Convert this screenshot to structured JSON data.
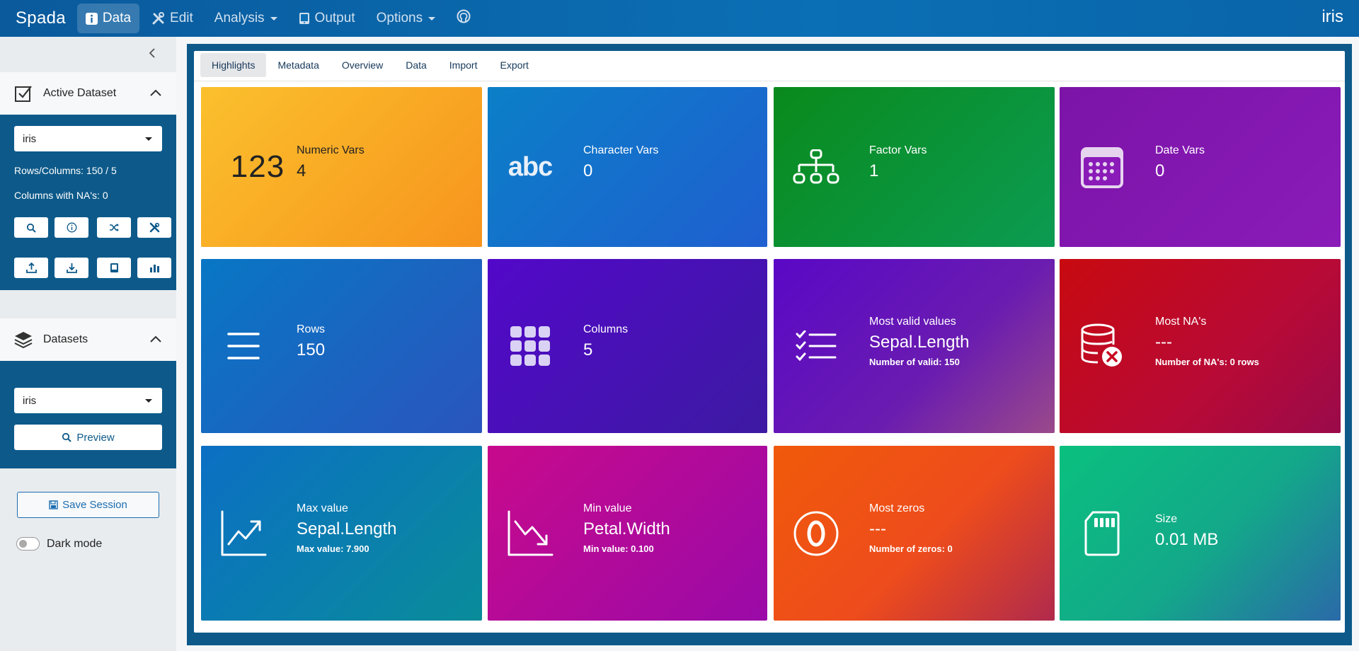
{
  "navbar": {
    "brand": "Spada",
    "items": [
      {
        "label": "Data"
      },
      {
        "label": "Edit"
      },
      {
        "label": "Analysis"
      },
      {
        "label": "Output"
      },
      {
        "label": "Options"
      }
    ],
    "dataset_name": "iris"
  },
  "sidebar": {
    "active_dataset": {
      "title": "Active Dataset",
      "selected": "iris",
      "rows_columns": "Rows/Columns: 150 / 5",
      "columns_na": "Columns with NA's: 0"
    },
    "datasets": {
      "title": "Datasets",
      "selected": "iris",
      "preview_label": "Preview"
    },
    "save_session_label": "Save Session",
    "dark_mode_label": "Dark mode"
  },
  "tabs": [
    "Highlights",
    "Metadata",
    "Overview",
    "Data",
    "Import",
    "Export"
  ],
  "tiles": {
    "numeric": {
      "icon_text": "123",
      "label": "Numeric Vars",
      "value": "4"
    },
    "character": {
      "icon_text": "abc",
      "label": "Character Vars",
      "value": "0"
    },
    "factor": {
      "label": "Factor Vars",
      "value": "1"
    },
    "date": {
      "label": "Date Vars",
      "value": "0"
    },
    "rows": {
      "label": "Rows",
      "value": "150"
    },
    "columns": {
      "label": "Columns",
      "value": "5"
    },
    "most_valid": {
      "label": "Most valid values",
      "value": "Sepal.Length",
      "sub": "Number of valid: 150"
    },
    "most_na": {
      "label": "Most NA's",
      "value": "---",
      "sub": "Number of NA's: 0 rows"
    },
    "max_value": {
      "label": "Max value",
      "value": "Sepal.Length",
      "sub": "Max value: 7.900"
    },
    "min_value": {
      "label": "Min value",
      "value": "Petal.Width",
      "sub": "Min value: 0.100"
    },
    "most_zeros": {
      "label": "Most zeros",
      "value": "---",
      "sub": "Number of zeros: 0"
    },
    "size": {
      "label": "Size",
      "value": "0.01 MB"
    }
  },
  "colors": {
    "navbar": "#0b6fb5",
    "sidebar_panel": "#0d5a8a",
    "yellow": "#f9b42a",
    "blue": "#1c6cc8",
    "green": "#0a8f2a",
    "purple": "#7a18b0",
    "indigo": "#4a0cc2",
    "red": "#c40a1e",
    "magenta": "#b80a9a",
    "orange": "#f25a12",
    "teal": "#10b888"
  }
}
